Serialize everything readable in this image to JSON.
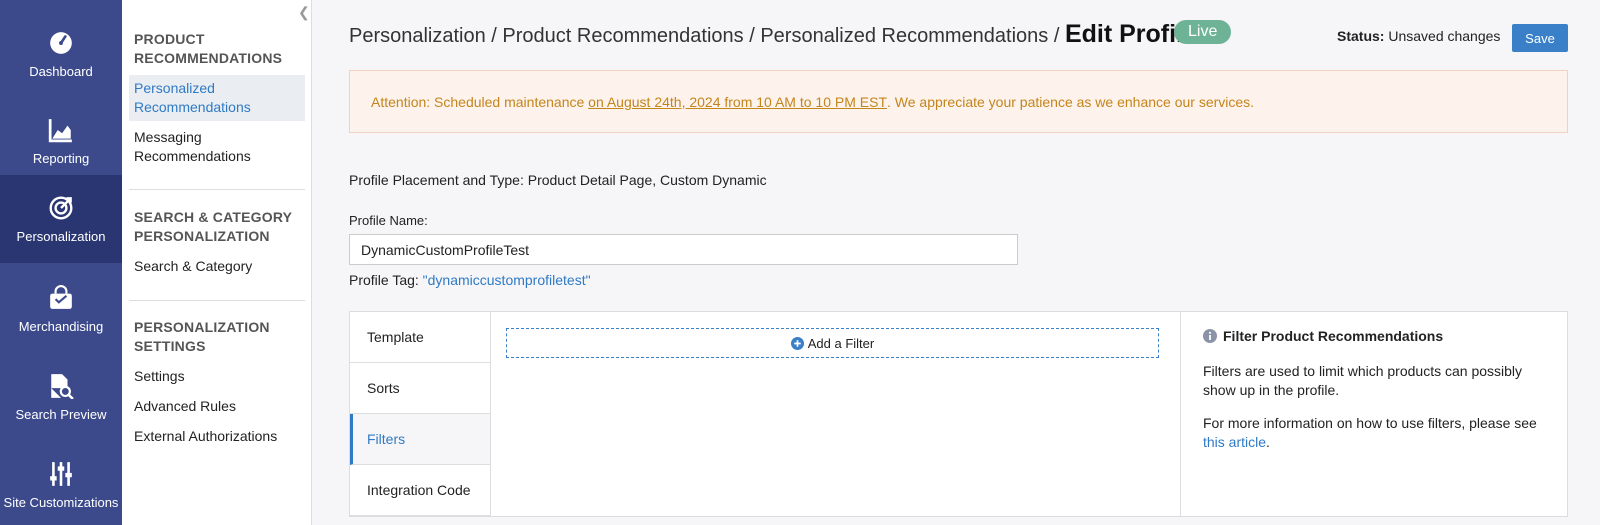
{
  "rail": {
    "items": [
      {
        "label": "Dashboard",
        "icon": "gauge-icon"
      },
      {
        "label": "Reporting",
        "icon": "chart-icon"
      },
      {
        "label": "Personalization",
        "icon": "target-icon",
        "active": true
      },
      {
        "label": "Merchandising",
        "icon": "shopping-bag-icon"
      },
      {
        "label": "Search Preview",
        "icon": "document-search-icon"
      },
      {
        "label": "Site Customizations",
        "icon": "sliders-icon"
      }
    ]
  },
  "subnav": {
    "section1": {
      "title_line1": "PRODUCT",
      "title_line2": "RECOMMENDATIONS"
    },
    "item_personalized_line1": "Personalized",
    "item_personalized_line2": "Recommendations",
    "item_messaging_line1": "Messaging",
    "item_messaging_line2": "Recommendations",
    "section2": {
      "title_line1": "SEARCH & CATEGORY",
      "title_line2": "PERSONALIZATION"
    },
    "item_search_category": "Search & Category",
    "section3": {
      "title_line1": "PERSONALIZATION",
      "title_line2": "SETTINGS"
    },
    "item_settings": "Settings",
    "item_advanced_rules": "Advanced Rules",
    "item_external_auth": "External Authorizations"
  },
  "header": {
    "crumb1": "Personalization",
    "crumb2": "Product Recommendations",
    "crumb3": "Personalized Recommendations",
    "separator": " / ",
    "current": "Edit Profile",
    "badge": "Live",
    "status_label": "Status:",
    "status_value": "Unsaved changes",
    "save_label": "Save"
  },
  "alert": {
    "prefix": "Attention: Scheduled maintenance ",
    "link": "on August 24th, 2024 from 10 AM to 10 PM EST",
    "suffix": ". We appreciate your patience as we enhance our services."
  },
  "profile": {
    "placement": "Profile Placement and Type: Product Detail Page, Custom Dynamic",
    "name_label": "Profile Name:",
    "name_value": "DynamicCustomProfileTest",
    "tag_label": "Profile Tag: ",
    "tag_value": "\"dynamiccustomprofiletest\""
  },
  "tabs": {
    "template": "Template",
    "sorts": "Sorts",
    "filters": "Filters",
    "integration": "Integration Code"
  },
  "filters": {
    "add_label": "Add a Filter"
  },
  "help": {
    "title": "Filter Product Recommendations",
    "p1": "Filters are used to limit which products can possibly show up in the profile.",
    "p2_text": "For more information on how to use filters, please see ",
    "p2_link": "this article",
    "p2_end": "."
  },
  "colors": {
    "rail": "#3c4a8c",
    "rail_active": "#2a3672",
    "accent": "#3a80c9",
    "live": "#6fb397",
    "alert_text": "#c4851b"
  }
}
